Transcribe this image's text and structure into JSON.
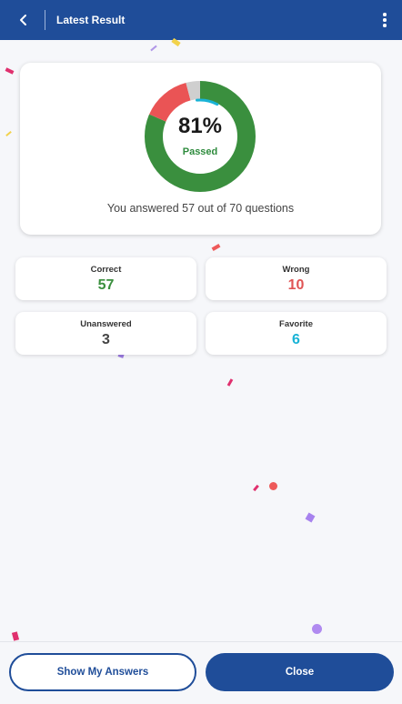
{
  "header": {
    "title": "Latest Result",
    "background": "#1f4d99",
    "back_icon": "chevron-left-icon",
    "menu_icon": "more-vertical-icon"
  },
  "result": {
    "percent_label": "81%",
    "status_label": "Passed",
    "summary": "You answered 57 out of 70 questions",
    "correct": 57,
    "wrong": 10,
    "unanswered": 3,
    "total": 70,
    "colors": {
      "correct": "#3a8f3e",
      "wrong": "#ea5455",
      "unanswered": "#cfcfcf",
      "favorite": "#19b3d6"
    }
  },
  "stats": [
    {
      "label": "Correct",
      "value": "57",
      "color": "#3a8f3e"
    },
    {
      "label": "Wrong",
      "value": "10",
      "color": "#e05454"
    },
    {
      "label": "Unanswered",
      "value": "3",
      "color": "#444444"
    },
    {
      "label": "Favorite",
      "value": "6",
      "color": "#19b3d6"
    }
  ],
  "actions": {
    "show_answers_label": "Show My Answers",
    "close_label": "Close"
  }
}
